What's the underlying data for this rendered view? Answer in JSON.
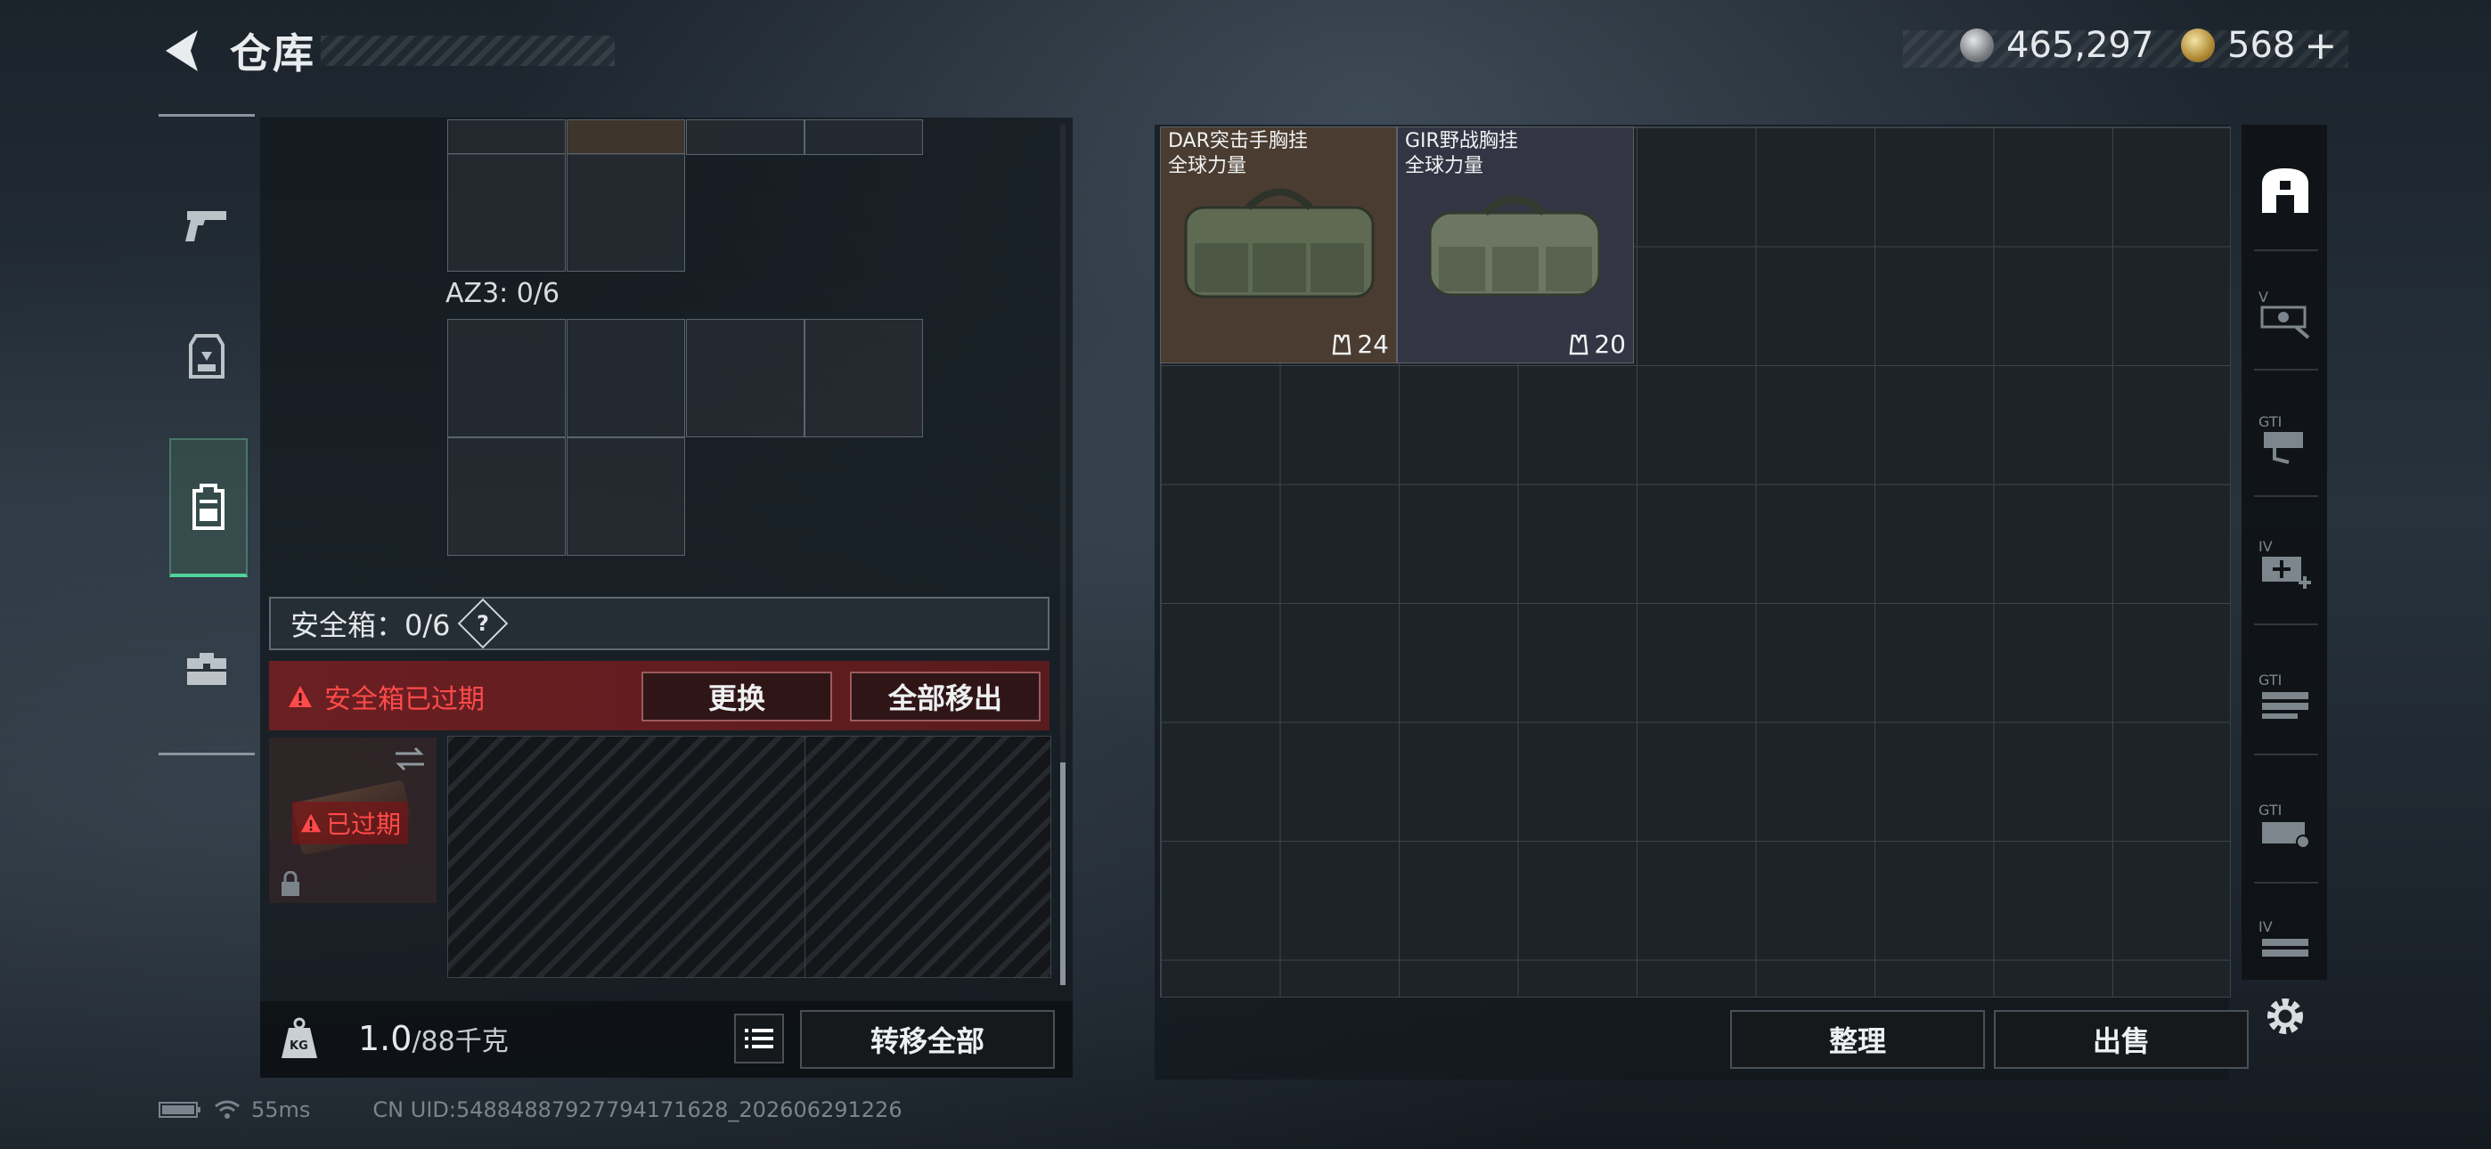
{
  "header": {
    "title": "仓库",
    "currency_silver": "465,297",
    "currency_gold": "568",
    "gold_add": "+"
  },
  "left_nav": {
    "items": [
      {
        "name": "pistol-icon"
      },
      {
        "name": "armor-icon"
      },
      {
        "name": "backpack-icon",
        "active": true
      },
      {
        "name": "toolbox-icon"
      }
    ]
  },
  "equipment": {
    "az3_label": "AZ3: 0/6",
    "safe_box_label": "安全箱：0/6",
    "safe_box_help": "?",
    "expired_warning": "安全箱已过期",
    "replace_button": "更换",
    "remove_all_button": "全部移出",
    "expired_badge": "已过期",
    "weight_value": "1.0",
    "weight_unit": "/88千克",
    "transfer_all_button": "转移全部"
  },
  "warehouse": {
    "items": [
      {
        "name_line1": "DAR突击手胸挂",
        "name_line2": "全球力量",
        "count": "24",
        "bg": "#4a3c30"
      },
      {
        "name_line1": "GIR野战胸挂",
        "name_line2": "全球力量",
        "count": "20",
        "bg": "#343544"
      }
    ],
    "sort_button": "整理",
    "sell_button": "出售"
  },
  "right_nav": {
    "labels": [
      "V",
      "GTI",
      "IV",
      "GTI",
      "GTI",
      "IV"
    ]
  },
  "status_bar": {
    "ping": "55ms",
    "uid": "CN UID:548848879277941716​28_202606291226"
  }
}
